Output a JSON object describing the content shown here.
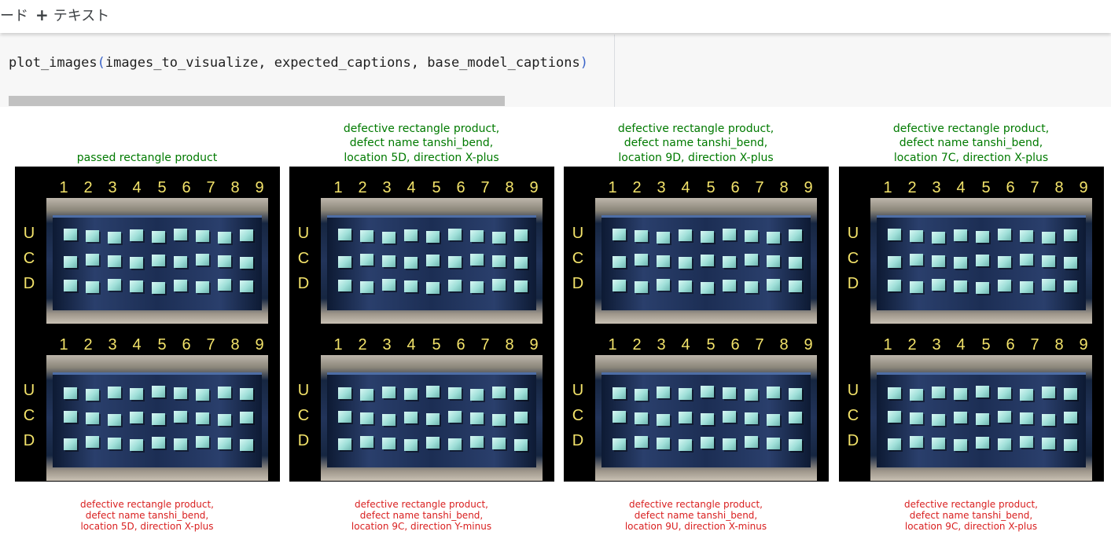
{
  "toolbar": {
    "code_button_tail": "ード",
    "add_text_plus": "+",
    "add_text_label": "テキスト"
  },
  "cell": {
    "code_func": "plot_images",
    "code_open": "(",
    "code_args": "images_to_visualize, expected_captions, base_model_captions",
    "code_close": ")"
  },
  "figure": {
    "column_numbers": [
      "1",
      "2",
      "3",
      "4",
      "5",
      "6",
      "7",
      "8",
      "9"
    ],
    "row_letters": [
      "U",
      "C",
      "D"
    ],
    "colors": {
      "expected_caption": "#007a00",
      "predicted_caption": "#d92020",
      "digit_labels": "#f3e36a"
    },
    "panels": [
      {
        "expected": [
          "passed rectangle product"
        ],
        "predicted": [
          "defective rectangle product,",
          "defect name tanshi_bend,",
          "location 5D, direction X-plus"
        ]
      },
      {
        "expected": [
          "defective rectangle product,",
          "defect name tanshi_bend,",
          "location 5D, direction X-plus"
        ],
        "predicted": [
          "defective rectangle product,",
          "defect name tanshi_bend,",
          "location 9C, direction Y-minus"
        ]
      },
      {
        "expected": [
          "defective rectangle product,",
          "defect name tanshi_bend,",
          "location 9D, direction X-plus"
        ],
        "predicted": [
          "defective rectangle product,",
          "defect name tanshi_bend,",
          "location 9U, direction X-minus"
        ]
      },
      {
        "expected": [
          "defective rectangle product,",
          "defect name tanshi_bend,",
          "location 7C, direction X-plus"
        ],
        "predicted": [
          "defective rectangle product,",
          "defect name tanshi_bend,",
          "location 9C, direction X-plus"
        ]
      }
    ]
  }
}
